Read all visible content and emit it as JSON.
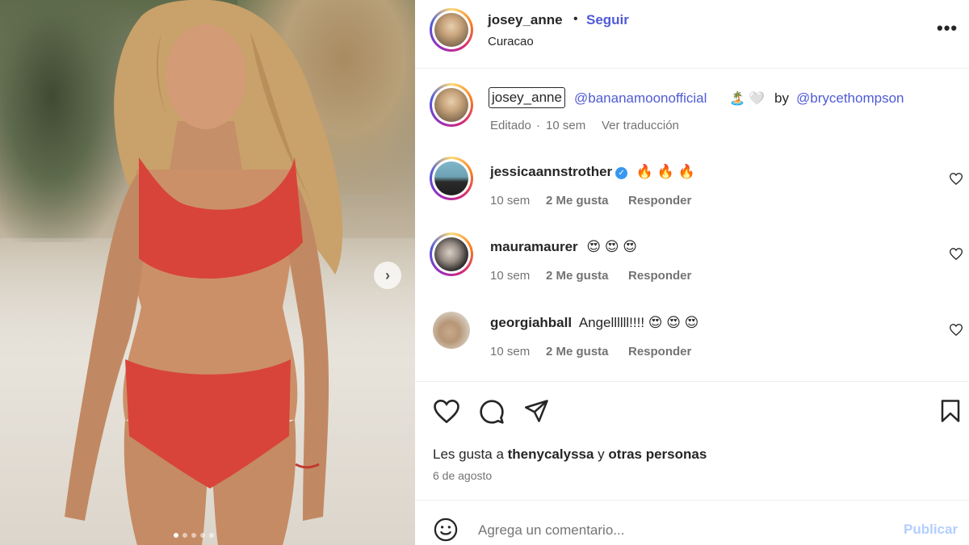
{
  "post": {
    "username": "josey_anne",
    "follow_label": "Seguir",
    "location": "Curacao",
    "more_label": "•••",
    "image_dots": 5,
    "image_active_dot": 0
  },
  "caption": {
    "username": "josey_anne",
    "mention_brand": "@bananamoonofficial",
    "emojis": "🏝️ 🤍",
    "by_label": "by",
    "mention_photographer": "@brycethompson",
    "edited_label": "Editado",
    "time": "10 sem",
    "translate_label": "Ver traducción"
  },
  "comments": [
    {
      "username": "jessicaannstrother",
      "text": "🔥 🔥 🔥",
      "time": "10 sem",
      "likes": "2 Me gusta",
      "reply": "Responder",
      "verified": true
    },
    {
      "username": "mauramaurer",
      "text": "😍 😍 😍",
      "time": "10 sem",
      "likes": "2 Me gusta",
      "reply": "Responder",
      "verified": false
    },
    {
      "username": "georgiahball",
      "text": "Angellllll!!!! 😍 😍 😍",
      "time": "10 sem",
      "likes": "2 Me gusta",
      "reply": "Responder",
      "verified": false
    }
  ],
  "likes": {
    "prefix": "Les gusta a",
    "user": "thenycalyssa",
    "connector": "y",
    "others": "otras personas"
  },
  "date": "6 de agosto",
  "add_comment": {
    "placeholder": "Agrega un comentario...",
    "publish_label": "Publicar"
  },
  "colors": {
    "link": "#4f5bd5",
    "muted": "#737373",
    "publish_disabled": "#b2cffd"
  }
}
